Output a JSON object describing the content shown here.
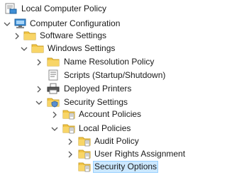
{
  "tree": {
    "root": {
      "label": "Local Computer Policy",
      "icon": "policy-computer-icon"
    },
    "computer_configuration": {
      "label": "Computer Configuration",
      "icon": "computer-icon",
      "expanded": true
    },
    "software_settings": {
      "label": "Software Settings",
      "icon": "folder-icon",
      "expanded": false
    },
    "windows_settings": {
      "label": "Windows Settings",
      "icon": "folder-icon",
      "expanded": true
    },
    "name_resolution_policy": {
      "label": "Name Resolution Policy",
      "icon": "folder-icon",
      "expanded": false
    },
    "scripts": {
      "label": "Scripts (Startup/Shutdown)",
      "icon": "script-icon"
    },
    "deployed_printers": {
      "label": "Deployed Printers",
      "icon": "printer-icon",
      "expanded": false
    },
    "security_settings": {
      "label": "Security Settings",
      "icon": "security-folder-icon",
      "expanded": true
    },
    "account_policies": {
      "label": "Account Policies",
      "icon": "policy-folder-icon",
      "expanded": false
    },
    "local_policies": {
      "label": "Local Policies",
      "icon": "policy-folder-icon",
      "expanded": true
    },
    "audit_policy": {
      "label": "Audit Policy",
      "icon": "policy-folder-icon",
      "expanded": false
    },
    "user_rights_assignment": {
      "label": "User Rights Assignment",
      "icon": "policy-folder-icon",
      "expanded": false
    },
    "security_options": {
      "label": "Security Options",
      "icon": "policy-folder-icon",
      "selected": true
    }
  },
  "colors": {
    "selection_bg": "#cce8ff",
    "selection_border": "#99d1ff",
    "folder": "#f3c544",
    "twisty": "#555555"
  }
}
